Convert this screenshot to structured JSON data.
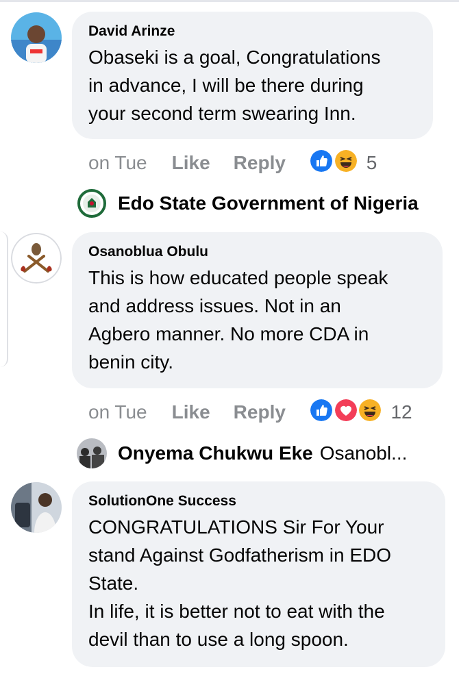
{
  "comments": [
    {
      "author": "David Arinze",
      "text": "Obaseki is a goal, Congratulations\nin advance, I will be there during\nyour second term swearing Inn.",
      "time": "on Tue",
      "like_label": "Like",
      "reply_label": "Reply",
      "reaction_icons": [
        "like-reaction-icon",
        "haha-reaction-icon"
      ],
      "reaction_count": "5",
      "reply_preview": {
        "author": "Edo State Government of Nigeria",
        "snippet": ""
      }
    },
    {
      "author": "Osanoblua Obulu",
      "text": "This is how educated people speak\nand address issues. Not in an\nAgbero manner. No more CDA  in\nbenin city.",
      "time": "on Tue",
      "like_label": "Like",
      "reply_label": "Reply",
      "reaction_icons": [
        "like-reaction-icon",
        "love-reaction-icon",
        "haha-reaction-icon"
      ],
      "reaction_count": "12",
      "reply_preview": {
        "author": "Onyema Chukwu Eke",
        "snippet": "Osanobl..."
      }
    },
    {
      "author": "SolutionOne Success",
      "text": "CONGRATULATIONS Sir For Your\nstand Against Godfatherism in EDO\nState.\nIn life, it is better not to eat with the\ndevil than to use a long spoon."
    }
  ],
  "colors": {
    "bubble": "#f0f2f5",
    "meta_text": "#8a8d91",
    "like_blue": "#1877f2",
    "love_red": "#f33e58",
    "haha_yellow": "#f7b125"
  }
}
